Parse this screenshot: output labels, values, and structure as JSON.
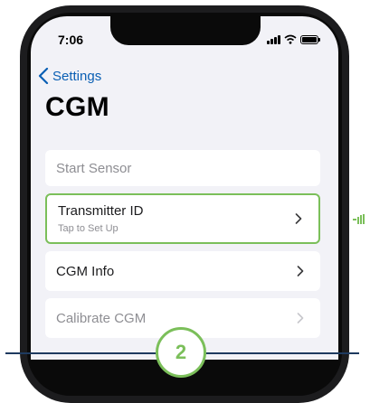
{
  "status_bar": {
    "time": "7:06"
  },
  "nav": {
    "back_label": "Settings"
  },
  "page": {
    "title": "CGM"
  },
  "items": [
    {
      "label": "Start Sensor",
      "enabled": false
    },
    {
      "label": "Transmitter ID",
      "subtitle": "Tap to Set Up",
      "enabled": true,
      "highlighted": true
    },
    {
      "label": "CGM Info",
      "enabled": true
    },
    {
      "label": "Calibrate CGM",
      "enabled": false
    }
  ],
  "step": {
    "number": "2"
  },
  "colors": {
    "accent": "#0a5fb4",
    "highlight": "#7bbf5a",
    "divider": "#1e3a5f"
  }
}
